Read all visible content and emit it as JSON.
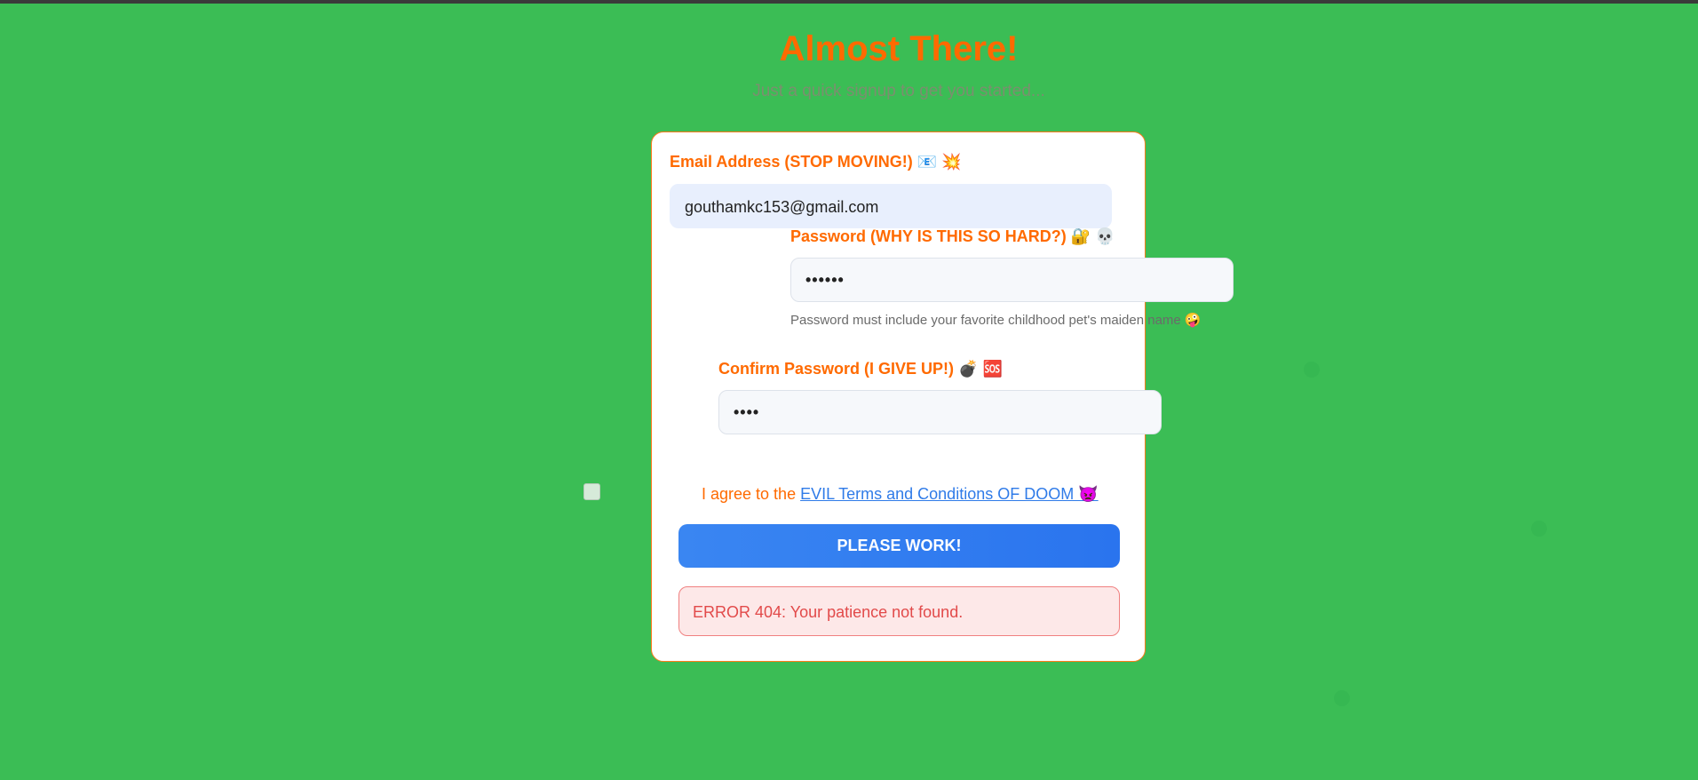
{
  "page": {
    "title": "Almost There!",
    "subtitle": "Just a quick signup to get you started..."
  },
  "form": {
    "email": {
      "label": "Email Address (STOP MOVING!) 📧 💥",
      "value": "gouthamkc153@gmail.com"
    },
    "password": {
      "label": "Password (WHY IS THIS SO HARD?) 🔐 💀",
      "value": "••••••",
      "hint": "Password must include your favorite childhood pet's maiden name 🤪"
    },
    "confirm_password": {
      "label": "Confirm Password (I GIVE UP!) 💣 🆘",
      "value": "••••"
    },
    "terms": {
      "prefix": "I agree to the",
      "link": "EVIL Terms and Conditions OF DOOM 👿"
    },
    "submit_label": "PLEASE WORK!",
    "error_message": "ERROR 404: Your patience not found."
  },
  "colors": {
    "background": "#3bbd55",
    "accent": "#ff6a00",
    "primary_button": "#2f7be8",
    "error": "#e24a4a"
  }
}
